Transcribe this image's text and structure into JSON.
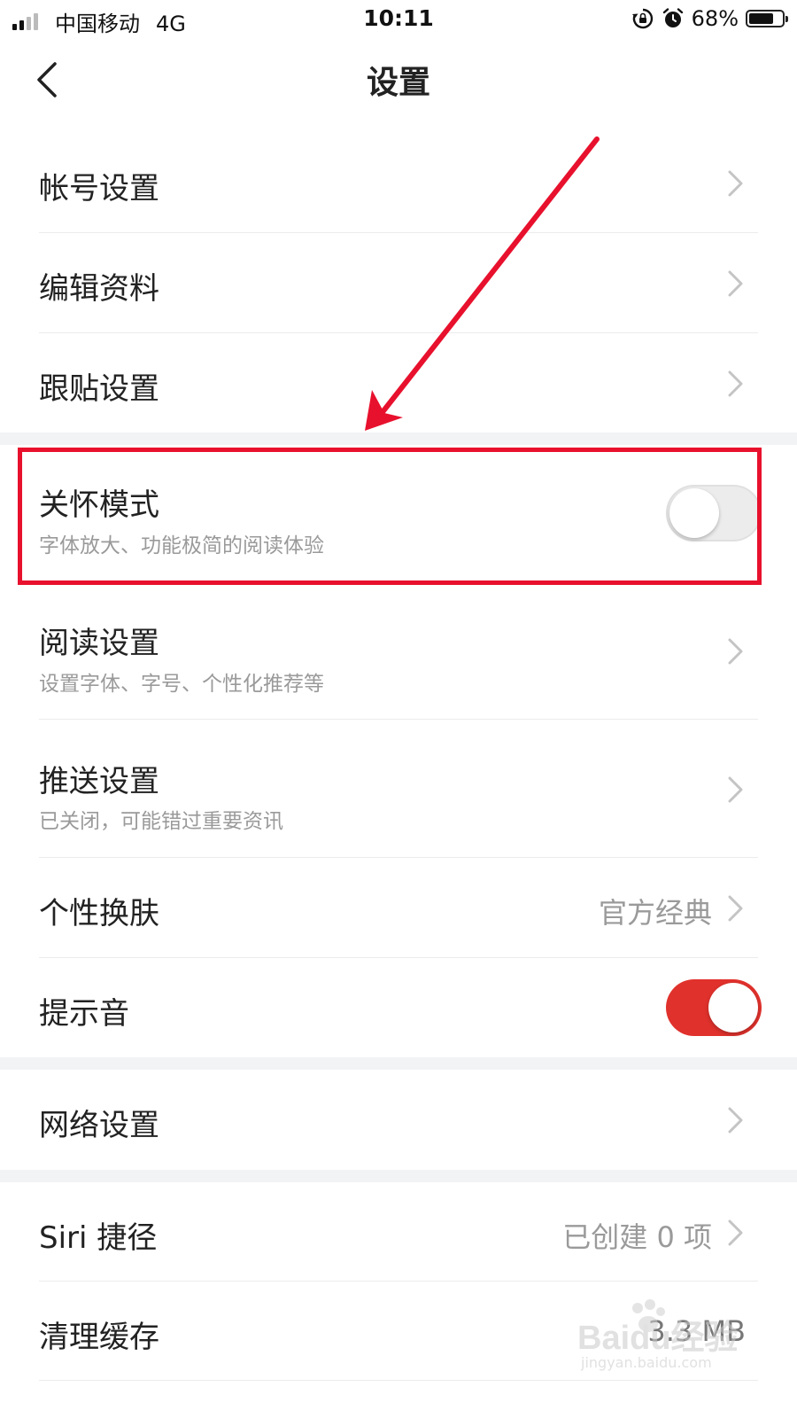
{
  "status_bar": {
    "carrier": "中国移动",
    "network": "4G",
    "time": "10:11",
    "battery_percent": "68%",
    "battery_level": 0.68
  },
  "nav": {
    "title": "设置",
    "back_icon": "chevron-left-icon"
  },
  "settings": {
    "account": {
      "label": "帐号设置"
    },
    "edit_profile": {
      "label": "编辑资料"
    },
    "reply": {
      "label": "跟贴设置"
    },
    "care_mode": {
      "label": "关怀模式",
      "description": "字体放大、功能极简的阅读体验",
      "enabled": false
    },
    "reading": {
      "label": "阅读设置",
      "description": "设置字体、字号、个性化推荐等"
    },
    "push": {
      "label": "推送设置",
      "description": "已关闭，可能错过重要资讯"
    },
    "skin": {
      "label": "个性换肤",
      "value": "官方经典"
    },
    "sound": {
      "label": "提示音",
      "enabled": true
    },
    "network": {
      "label": "网络设置"
    },
    "siri": {
      "label": "Siri 捷径",
      "value": "已创建 0 项"
    },
    "cache": {
      "label": "清理缓存",
      "value": "3.3 MB"
    }
  },
  "watermark": {
    "brand": "Baidu经验",
    "url": "jingyan.baidu.com"
  },
  "colors": {
    "accent": "#e0312c",
    "annotation": "#e8112d",
    "section_gap": "#f2f3f5",
    "secondary_text": "#9a9a9a"
  }
}
